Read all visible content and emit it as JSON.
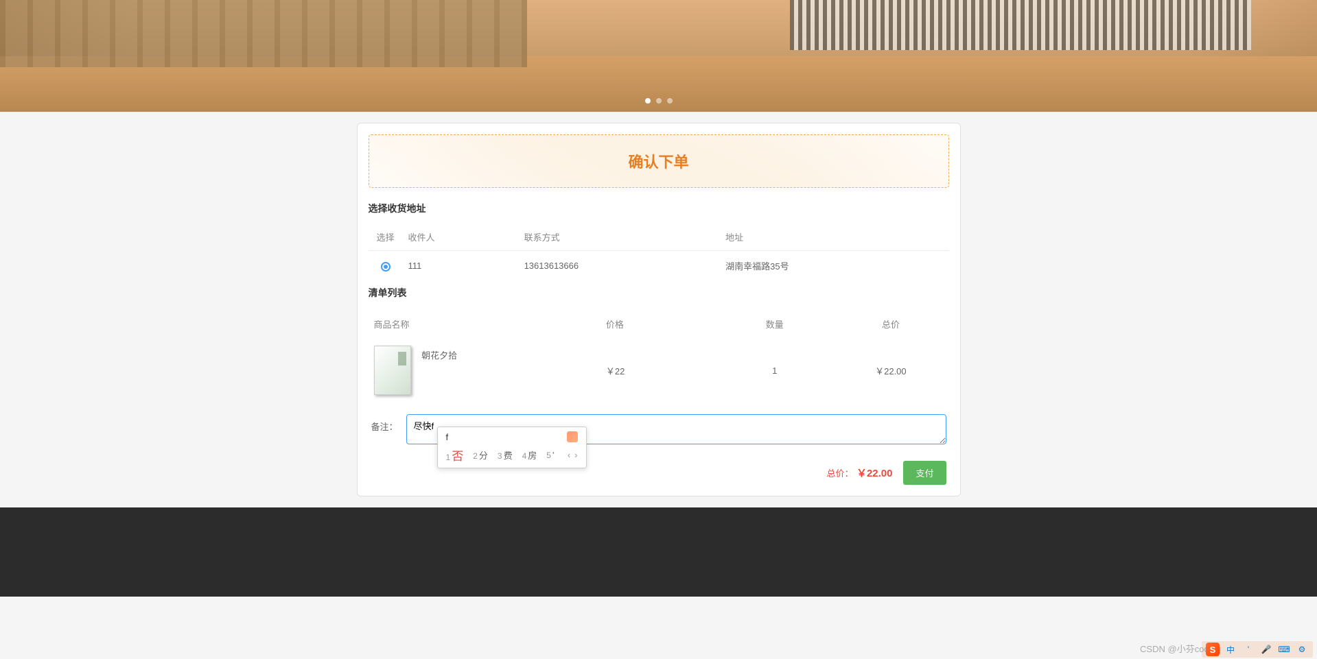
{
  "banner": {
    "carousel_active": 0
  },
  "order": {
    "title": "确认下单",
    "address_section": "选择收货地址",
    "address_headers": {
      "select": "选择",
      "recipient": "收件人",
      "contact": "联系方式",
      "address": "地址"
    },
    "addresses": [
      {
        "recipient": "111",
        "contact": "13613613666",
        "address": "湖南幸福路35号"
      }
    ],
    "items_section": "清单列表",
    "item_headers": {
      "name": "商品名称",
      "price": "价格",
      "qty": "数量",
      "subtotal": "总价"
    },
    "items": [
      {
        "name": "朝花夕拾",
        "price": "￥22",
        "qty": "1",
        "subtotal": "￥22.00"
      }
    ],
    "remark_label": "备注：",
    "remark_value": "尽快f",
    "total_label": "总价：",
    "total_value": "￥22.00",
    "pay_button": "支付"
  },
  "ime": {
    "input": "f",
    "candidates": [
      {
        "num": "1",
        "ch": "否"
      },
      {
        "num": "2",
        "ch": "分"
      },
      {
        "num": "3",
        "ch": "费"
      },
      {
        "num": "4",
        "ch": "房"
      },
      {
        "num": "5",
        "ch": "'"
      }
    ],
    "prev": "‹",
    "next": "›"
  },
  "taskbar": {
    "sogou": "S",
    "lang": "中",
    "punct": "'",
    "mic": "🎤",
    "kb": "⌨",
    "tool": "⚙"
  },
  "watermark": "CSDN @小芬coding"
}
